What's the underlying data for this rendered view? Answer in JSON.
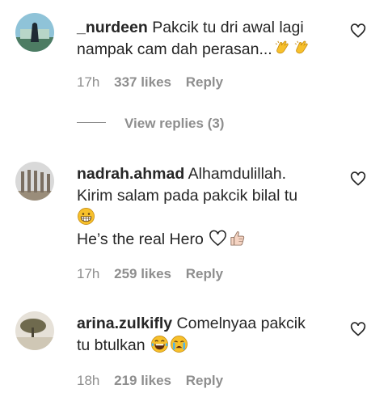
{
  "comments": [
    {
      "username": "_nurdeen",
      "text_line1": "Pakcik tu dri awal lagi",
      "text_line2": "nampak cam dah perasan...",
      "time": "17h",
      "likes": "337 likes",
      "reply": "Reply",
      "view_replies": "View replies (3)",
      "emojis": [
        "clapping-hands",
        "clapping-hands"
      ]
    },
    {
      "username": "nadrah.ahmad",
      "text_line1": "Alhamdulillah.",
      "text_line2": "Kirim salam pada pakcik bilal tu",
      "text_line3": "He’s the real Hero",
      "time": "17h",
      "likes": "259 likes",
      "reply": "Reply",
      "emojis": [
        "grinning-face",
        "white-heart",
        "thumbs-up"
      ]
    },
    {
      "username": "arina.zulkifly",
      "text_line1": "Comelnyaa pakcik",
      "text_line2": "tu btulkan",
      "time": "18h",
      "likes": "219 likes",
      "reply": "Reply",
      "emojis": [
        "laughing-tears-face",
        "crying-face"
      ]
    }
  ],
  "icons": {
    "like": "heart-outline-icon"
  },
  "colors": {
    "text": "#262626",
    "secondary": "#8e8e8e",
    "emoji_yellow": "#f7c02b"
  }
}
